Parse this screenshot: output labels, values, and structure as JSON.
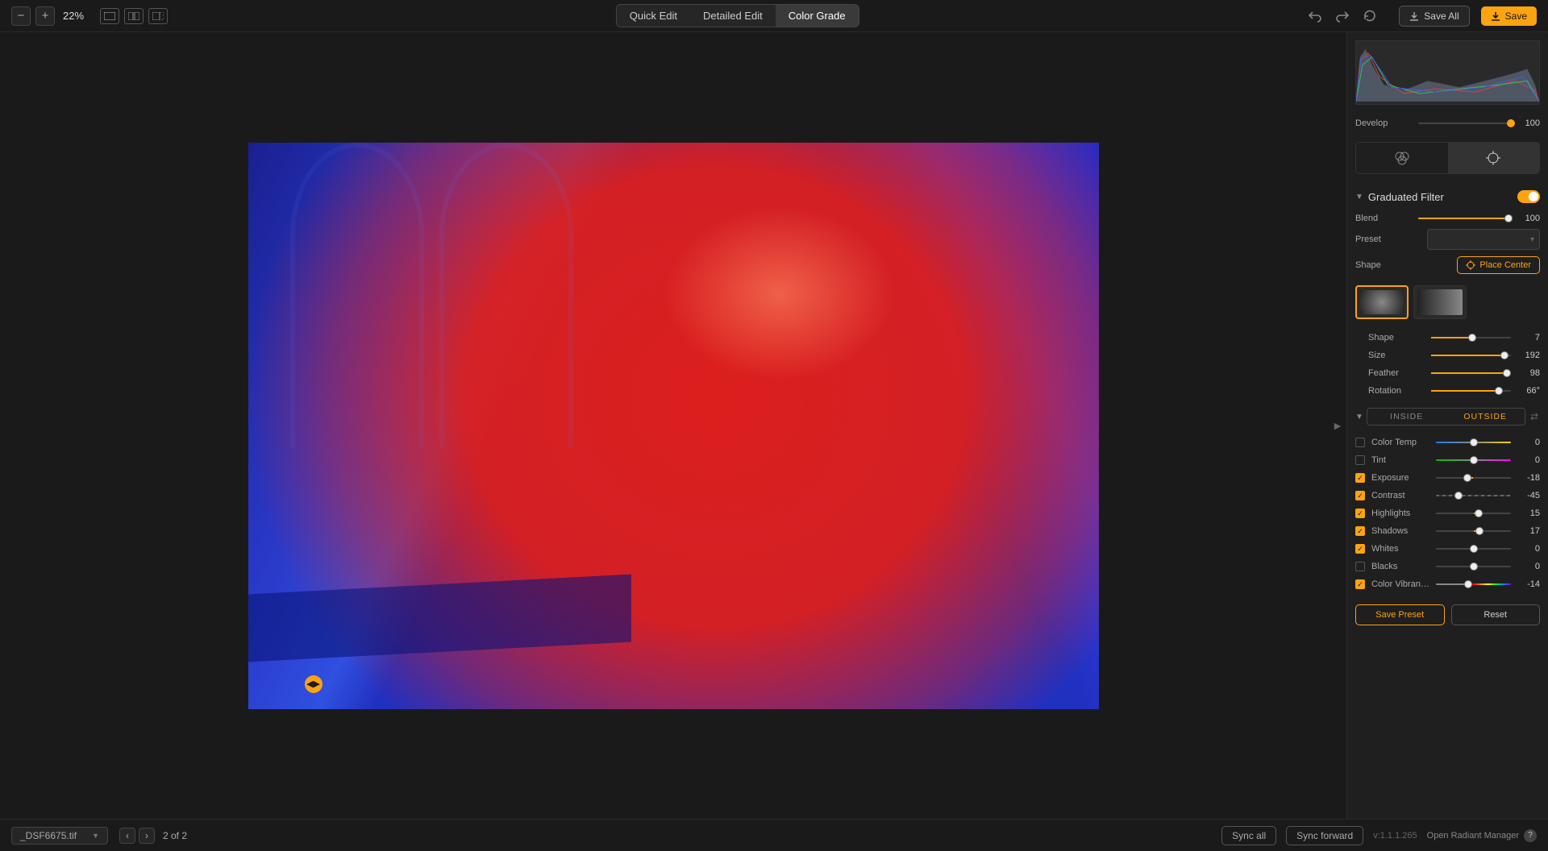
{
  "topbar": {
    "zoom_minus": "−",
    "zoom_plus": "+",
    "zoom_value": "22%",
    "modes": {
      "quick": "Quick Edit",
      "detailed": "Detailed Edit",
      "color": "Color Grade"
    },
    "save_all": "Save All",
    "save": "Save"
  },
  "panel": {
    "develop": {
      "label": "Develop",
      "value": "100",
      "pct": 100
    },
    "section_title": "Graduated Filter",
    "blend": {
      "label": "Blend",
      "value": "100",
      "pct": 97
    },
    "preset_label": "Preset",
    "shape_label": "Shape",
    "place_center": "Place Center",
    "shape_sliders": {
      "shape": {
        "label": "Shape",
        "value": "7",
        "pct": 52
      },
      "size": {
        "label": "Size",
        "value": "192",
        "pct": 92
      },
      "feather": {
        "label": "Feather",
        "value": "98",
        "pct": 95
      },
      "rotation": {
        "label": "Rotation",
        "value": "66°",
        "pct": 85
      }
    },
    "io": {
      "inside": "INSIDE",
      "outside": "OUTSIDE"
    },
    "adjust": {
      "color_temp": {
        "label": "Color Temp",
        "value": "0",
        "pct": 50,
        "on": false,
        "grad": "gradient-temp"
      },
      "tint": {
        "label": "Tint",
        "value": "0",
        "pct": 50,
        "on": false,
        "grad": "gradient-tint"
      },
      "exposure": {
        "label": "Exposure",
        "value": "-18",
        "pct": 42,
        "on": true,
        "grad": ""
      },
      "contrast": {
        "label": "Contrast",
        "value": "-45",
        "pct": 30,
        "on": true,
        "grad": "gradient-contrast"
      },
      "highlights": {
        "label": "Highlights",
        "value": "15",
        "pct": 57,
        "on": true,
        "grad": ""
      },
      "shadows": {
        "label": "Shadows",
        "value": "17",
        "pct": 58,
        "on": true,
        "grad": ""
      },
      "whites": {
        "label": "Whites",
        "value": "0",
        "pct": 50,
        "on": true,
        "grad": ""
      },
      "blacks": {
        "label": "Blacks",
        "value": "0",
        "pct": 50,
        "on": false,
        "grad": ""
      },
      "color_vibrance": {
        "label": "Color Vibrance",
        "value": "-14",
        "pct": 43,
        "on": true,
        "grad": "gradient-vibrance"
      }
    },
    "save_preset": "Save Preset",
    "reset": "Reset"
  },
  "bottom": {
    "filename": "_DSF6675.tif",
    "page": "2 of 2",
    "sync_all": "Sync all",
    "sync_forward": "Sync forward",
    "version": "v:1.1.1.265",
    "manager": "Open Radiant Manager"
  }
}
